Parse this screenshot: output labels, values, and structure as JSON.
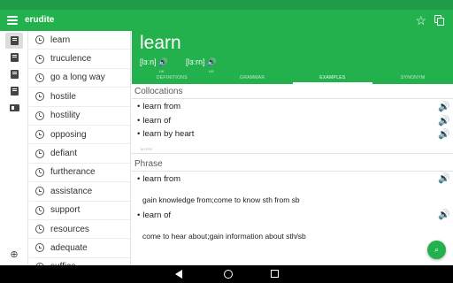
{
  "app": {
    "title": "erudite"
  },
  "icons": {
    "menu": "menu-icon",
    "favorite": "star-outline-icon",
    "copy": "copy-icon",
    "rail": [
      "dictionary-icon",
      "wordbook-icon",
      "notebook-icon",
      "book-icon",
      "flashcard-icon",
      "globe-icon"
    ],
    "history": "history-clock-icon",
    "speaker": "speaker-icon",
    "search": "search-icon"
  },
  "colors": {
    "primary": "#22b14c",
    "statusbar": "#1e9c48",
    "accent": "#22b14c"
  },
  "history": [
    "learn",
    "truculence",
    "go a long way",
    "hostile",
    "hostility",
    "opposing",
    "defiant",
    "furtherance",
    "assistance",
    "support",
    "resources",
    "adequate",
    "suffice"
  ],
  "entry": {
    "word": "learn",
    "pronunciations": [
      {
        "text": "[lɜːn]",
        "tag": "UK"
      },
      {
        "text": "[lɜːrn]",
        "tag": "US"
      }
    ],
    "tabs": [
      "DEFINITIONS",
      "GRAMMAR",
      "EXAMPLES",
      "SYNONYM"
    ],
    "active_tab": "EXAMPLES"
  },
  "collocations": {
    "heading": "Collocations",
    "items": [
      "learn from",
      "learn of",
      "learn by heart"
    ],
    "more_label": "MORE"
  },
  "phrase": {
    "heading": "Phrase",
    "items": [
      {
        "term": "learn from",
        "definition": "gain knowledge from;come to know sth from sb"
      },
      {
        "term": "learn of",
        "definition": "come to hear about;gain information about sth/sb"
      }
    ]
  }
}
